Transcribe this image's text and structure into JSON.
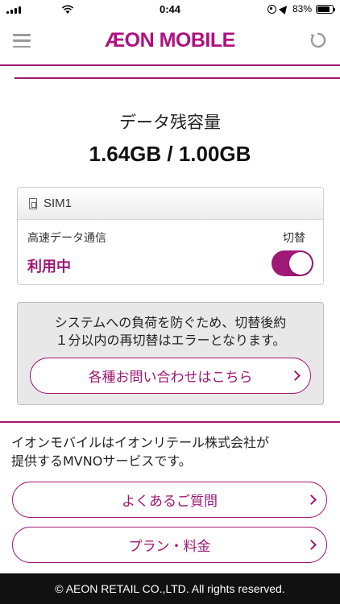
{
  "status_bar": {
    "time": "0:44",
    "battery": "83%",
    "battery_level": 0.83
  },
  "header": {
    "logo_text": "ÆON MOBILE",
    "menu_icon": "hamburger-icon",
    "refresh_icon": "refresh-icon"
  },
  "data_usage": {
    "title": "データ残容量",
    "amount": "1.64GB / 1.00GB"
  },
  "sim": {
    "name": "SIM1",
    "speed_label": "高速データ通信",
    "switch_label": "切替",
    "status": "利用中",
    "toggle_on": true
  },
  "notice": {
    "text_line1": "システムへの負荷を防ぐため、切替後約",
    "text_line2": "１分以内の再切替はエラーとなります。",
    "contact_button": "各種お問い合わせはこちら"
  },
  "info": {
    "text_line1": "イオンモバイルはイオンリテール株式会社が",
    "text_line2": "提供するMVNOサービスです。",
    "faq_button": "よくあるご質問",
    "plan_button": "プラン・料金"
  },
  "footer": {
    "copyright": "© AEON RETAIL CO.,LTD. All rights reserved."
  },
  "colors": {
    "brand": "#a01876",
    "background": "#ffffff",
    "notice_bg": "#e8e8e8",
    "footer_bg": "#111111"
  }
}
